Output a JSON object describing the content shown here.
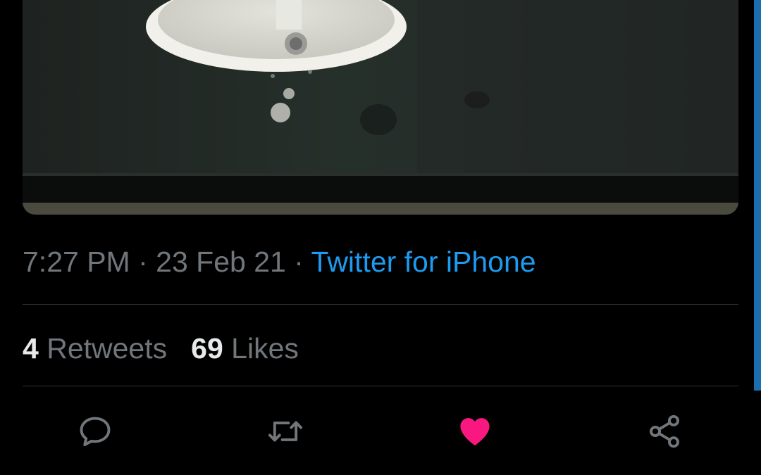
{
  "tweet": {
    "media": {
      "description_icon": "photo-of-black-countertop-with-sink"
    },
    "timestamp": {
      "time": "7:27 PM",
      "separator": "·",
      "date": "23 Feb 21",
      "source": "Twitter for iPhone"
    },
    "stats": {
      "retweets_count": "4",
      "retweets_label": "Retweets",
      "likes_count": "69",
      "likes_label": "Likes"
    },
    "actions": [
      {
        "name": "reply",
        "icon": "comment-bubble-icon"
      },
      {
        "name": "retweet",
        "icon": "retweet-arrows-icon"
      },
      {
        "name": "like",
        "icon": "heart-filled-icon",
        "active": true
      },
      {
        "name": "share",
        "icon": "share-nodes-icon"
      }
    ]
  },
  "colors": {
    "background": "#000000",
    "muted_text": "#71767b",
    "primary_text": "#e7e9ea",
    "link": "#1d9bf0",
    "like_active": "#f91880",
    "divider": "#2f3336"
  }
}
